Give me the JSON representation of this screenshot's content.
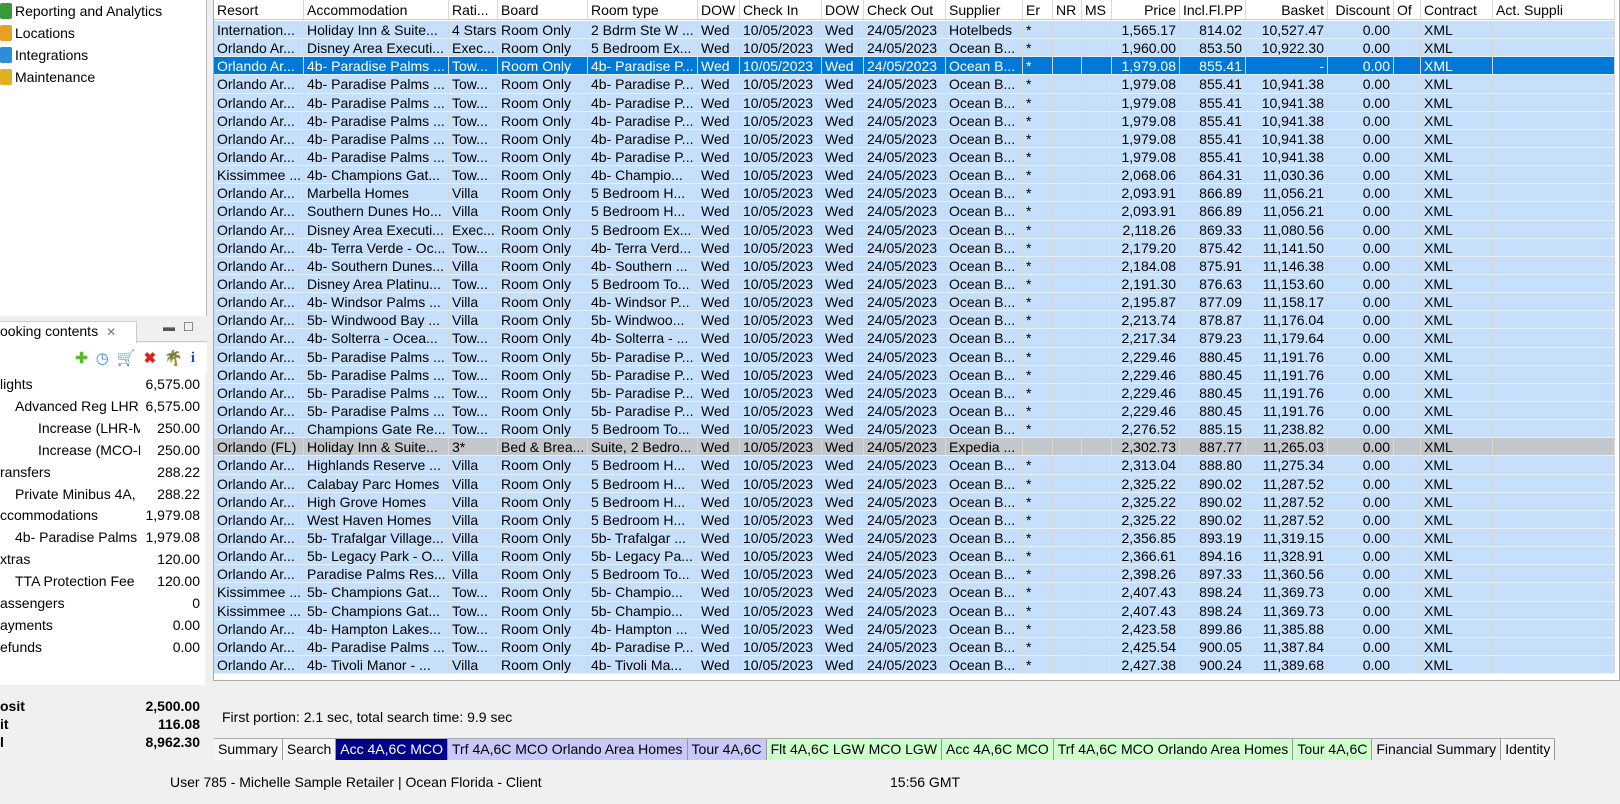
{
  "tree": [
    {
      "label": "Reporting and Analytics",
      "icon": "report-icon"
    },
    {
      "label": "Locations",
      "icon": "locations-icon"
    },
    {
      "label": "Integrations",
      "icon": "integrations-icon"
    },
    {
      "label": "Maintenance",
      "icon": "maintenance-icon"
    }
  ],
  "booking": {
    "title": "ooking contents",
    "rows": [
      {
        "label": "lights",
        "amount": "6,575.00",
        "indent": 0
      },
      {
        "label": "Advanced Reg LHR:",
        "amount": "6,575.00",
        "indent": 1
      },
      {
        "label": "Increase (LHR-M",
        "amount": "250.00",
        "indent": 2
      },
      {
        "label": "Increase (MCO-I",
        "amount": "250.00",
        "indent": 2
      },
      {
        "label": "ransfers",
        "amount": "288.22",
        "indent": 0
      },
      {
        "label": "Private Minibus  4A,",
        "amount": "288.22",
        "indent": 1
      },
      {
        "label": "ccommodations",
        "amount": "1,979.08",
        "indent": 0
      },
      {
        "label": "4b- Paradise Palms",
        "amount": "1,979.08",
        "indent": 1
      },
      {
        "label": "xtras",
        "amount": "120.00",
        "indent": 0
      },
      {
        "label": "TTA Protection Fee",
        "amount": "120.00",
        "indent": 1
      },
      {
        "label": "assengers",
        "amount": "0",
        "indent": 0
      },
      {
        "label": "ayments",
        "amount": "0.00",
        "indent": 0
      },
      {
        "label": "efunds",
        "amount": "0.00",
        "indent": 0
      }
    ],
    "totals": [
      {
        "label": "osit",
        "amount": "2,500.00"
      },
      {
        "label": "it",
        "amount": "116.08"
      },
      {
        "label": "l",
        "amount": "8,962.30"
      }
    ]
  },
  "table": {
    "columns": [
      "Resort",
      "Accommodation",
      "Rati...",
      "Board",
      "Room type",
      "DOW",
      "Check In",
      "DOW",
      "Check Out",
      "Supplier",
      "Er",
      "NR",
      "MS",
      "Price",
      "Incl.Fl.PP",
      "Basket",
      "Discount",
      "Of",
      "Contract",
      "Act. Suppli"
    ],
    "rows": [
      [
        "Internation...",
        "Holiday Inn & Suite...",
        "4 Stars",
        "Room Only",
        "2 Bdrm Ste W ...",
        "Wed",
        "10/05/2023",
        "Wed",
        "24/05/2023",
        "Hotelbeds",
        "*",
        "",
        "",
        "1,565.17",
        "814.02",
        "10,527.47",
        "0.00",
        "",
        "XML",
        ""
      ],
      [
        "Orlando Ar...",
        "Disney Area Executi...",
        "Exec...",
        "Room Only",
        "5 Bedroom Ex...",
        "Wed",
        "10/05/2023",
        "Wed",
        "24/05/2023",
        "Ocean B...",
        "*",
        "",
        "",
        "1,960.00",
        "853.50",
        "10,922.30",
        "0.00",
        "",
        "XML",
        ""
      ],
      [
        "Orlando Ar...",
        "4b- Paradise Palms ...",
        "Tow...",
        "Room Only",
        "4b- Paradise P...",
        "Wed",
        "10/05/2023",
        "Wed",
        "24/05/2023",
        "Ocean B...",
        "*",
        "",
        "",
        "1,979.08",
        "855.41",
        "-",
        "0.00",
        "",
        "XML",
        ""
      ],
      [
        "Orlando Ar...",
        "4b- Paradise Palms ...",
        "Tow...",
        "Room Only",
        "4b- Paradise P...",
        "Wed",
        "10/05/2023",
        "Wed",
        "24/05/2023",
        "Ocean B...",
        "*",
        "",
        "",
        "1,979.08",
        "855.41",
        "10,941.38",
        "0.00",
        "",
        "XML",
        ""
      ],
      [
        "Orlando Ar...",
        "4b- Paradise Palms ...",
        "Tow...",
        "Room Only",
        "4b- Paradise P...",
        "Wed",
        "10/05/2023",
        "Wed",
        "24/05/2023",
        "Ocean B...",
        "*",
        "",
        "",
        "1,979.08",
        "855.41",
        "10,941.38",
        "0.00",
        "",
        "XML",
        ""
      ],
      [
        "Orlando Ar...",
        "4b- Paradise Palms ...",
        "Tow...",
        "Room Only",
        "4b- Paradise P...",
        "Wed",
        "10/05/2023",
        "Wed",
        "24/05/2023",
        "Ocean B...",
        "*",
        "",
        "",
        "1,979.08",
        "855.41",
        "10,941.38",
        "0.00",
        "",
        "XML",
        ""
      ],
      [
        "Orlando Ar...",
        "4b- Paradise Palms ...",
        "Tow...",
        "Room Only",
        "4b- Paradise P...",
        "Wed",
        "10/05/2023",
        "Wed",
        "24/05/2023",
        "Ocean B...",
        "*",
        "",
        "",
        "1,979.08",
        "855.41",
        "10,941.38",
        "0.00",
        "",
        "XML",
        ""
      ],
      [
        "Orlando Ar...",
        "4b- Paradise Palms ...",
        "Tow...",
        "Room Only",
        "4b- Paradise P...",
        "Wed",
        "10/05/2023",
        "Wed",
        "24/05/2023",
        "Ocean B...",
        "*",
        "",
        "",
        "1,979.08",
        "855.41",
        "10,941.38",
        "0.00",
        "",
        "XML",
        ""
      ],
      [
        "Kissimmee ...",
        "4b- Champions Gat...",
        "Tow...",
        "Room Only",
        "4b- Champio...",
        "Wed",
        "10/05/2023",
        "Wed",
        "24/05/2023",
        "Ocean B...",
        "*",
        "",
        "",
        "2,068.06",
        "864.31",
        "11,030.36",
        "0.00",
        "",
        "XML",
        ""
      ],
      [
        "Orlando Ar...",
        "Marbella Homes",
        "Villa",
        "Room Only",
        "5 Bedroom H...",
        "Wed",
        "10/05/2023",
        "Wed",
        "24/05/2023",
        "Ocean B...",
        "*",
        "",
        "",
        "2,093.91",
        "866.89",
        "11,056.21",
        "0.00",
        "",
        "XML",
        ""
      ],
      [
        "Orlando Ar...",
        "Southern Dunes Ho...",
        "Villa",
        "Room Only",
        "5 Bedroom H...",
        "Wed",
        "10/05/2023",
        "Wed",
        "24/05/2023",
        "Ocean B...",
        "*",
        "",
        "",
        "2,093.91",
        "866.89",
        "11,056.21",
        "0.00",
        "",
        "XML",
        ""
      ],
      [
        "Orlando Ar...",
        "Disney Area Executi...",
        "Exec...",
        "Room Only",
        "5 Bedroom Ex...",
        "Wed",
        "10/05/2023",
        "Wed",
        "24/05/2023",
        "Ocean B...",
        "*",
        "",
        "",
        "2,118.26",
        "869.33",
        "11,080.56",
        "0.00",
        "",
        "XML",
        ""
      ],
      [
        "Orlando Ar...",
        "4b- Terra Verde - Oc...",
        "Tow...",
        "Room Only",
        "4b- Terra Verd...",
        "Wed",
        "10/05/2023",
        "Wed",
        "24/05/2023",
        "Ocean B...",
        "*",
        "",
        "",
        "2,179.20",
        "875.42",
        "11,141.50",
        "0.00",
        "",
        "XML",
        ""
      ],
      [
        "Orlando Ar...",
        "4b- Southern Dunes...",
        "Villa",
        "Room Only",
        "4b- Southern ...",
        "Wed",
        "10/05/2023",
        "Wed",
        "24/05/2023",
        "Ocean B...",
        "*",
        "",
        "",
        "2,184.08",
        "875.91",
        "11,146.38",
        "0.00",
        "",
        "XML",
        ""
      ],
      [
        "Orlando Ar...",
        "Disney Area Platinu...",
        "Tow...",
        "Room Only",
        "5 Bedroom To...",
        "Wed",
        "10/05/2023",
        "Wed",
        "24/05/2023",
        "Ocean B...",
        "*",
        "",
        "",
        "2,191.30",
        "876.63",
        "11,153.60",
        "0.00",
        "",
        "XML",
        ""
      ],
      [
        "Orlando Ar...",
        "4b- Windsor Palms ...",
        "Villa",
        "Room Only",
        "4b- Windsor P...",
        "Wed",
        "10/05/2023",
        "Wed",
        "24/05/2023",
        "Ocean B...",
        "*",
        "",
        "",
        "2,195.87",
        "877.09",
        "11,158.17",
        "0.00",
        "",
        "XML",
        ""
      ],
      [
        "Orlando Ar...",
        "5b- Windwood Bay ...",
        "Villa",
        "Room Only",
        "5b- Windwoo...",
        "Wed",
        "10/05/2023",
        "Wed",
        "24/05/2023",
        "Ocean B...",
        "*",
        "",
        "",
        "2,213.74",
        "878.87",
        "11,176.04",
        "0.00",
        "",
        "XML",
        ""
      ],
      [
        "Orlando Ar...",
        "4b- Solterra - Ocea...",
        "Tow...",
        "Room Only",
        "4b- Solterra - ...",
        "Wed",
        "10/05/2023",
        "Wed",
        "24/05/2023",
        "Ocean B...",
        "*",
        "",
        "",
        "2,217.34",
        "879.23",
        "11,179.64",
        "0.00",
        "",
        "XML",
        ""
      ],
      [
        "Orlando Ar...",
        "5b- Paradise Palms ...",
        "Tow...",
        "Room Only",
        "5b- Paradise P...",
        "Wed",
        "10/05/2023",
        "Wed",
        "24/05/2023",
        "Ocean B...",
        "*",
        "",
        "",
        "2,229.46",
        "880.45",
        "11,191.76",
        "0.00",
        "",
        "XML",
        ""
      ],
      [
        "Orlando Ar...",
        "5b- Paradise Palms ...",
        "Tow...",
        "Room Only",
        "5b- Paradise P...",
        "Wed",
        "10/05/2023",
        "Wed",
        "24/05/2023",
        "Ocean B...",
        "*",
        "",
        "",
        "2,229.46",
        "880.45",
        "11,191.76",
        "0.00",
        "",
        "XML",
        ""
      ],
      [
        "Orlando Ar...",
        "5b- Paradise Palms ...",
        "Tow...",
        "Room Only",
        "5b- Paradise P...",
        "Wed",
        "10/05/2023",
        "Wed",
        "24/05/2023",
        "Ocean B...",
        "*",
        "",
        "",
        "2,229.46",
        "880.45",
        "11,191.76",
        "0.00",
        "",
        "XML",
        ""
      ],
      [
        "Orlando Ar...",
        "5b- Paradise Palms ...",
        "Tow...",
        "Room Only",
        "5b- Paradise P...",
        "Wed",
        "10/05/2023",
        "Wed",
        "24/05/2023",
        "Ocean B...",
        "*",
        "",
        "",
        "2,229.46",
        "880.45",
        "11,191.76",
        "0.00",
        "",
        "XML",
        ""
      ],
      [
        "Orlando Ar...",
        "Champions Gate Re...",
        "Tow...",
        "Room Only",
        "5 Bedroom To...",
        "Wed",
        "10/05/2023",
        "Wed",
        "24/05/2023",
        "Ocean B...",
        "*",
        "",
        "",
        "2,276.52",
        "885.15",
        "11,238.82",
        "0.00",
        "",
        "XML",
        ""
      ],
      [
        "Orlando (FL)",
        "Holiday Inn & Suite...",
        "3*",
        "Bed & Brea...",
        "Suite, 2 Bedro...",
        "Wed",
        "10/05/2023",
        "Wed",
        "24/05/2023",
        "Expedia ...",
        "",
        "",
        "",
        "2,302.73",
        "887.77",
        "11,265.03",
        "0.00",
        "",
        "XML",
        ""
      ],
      [
        "Orlando Ar...",
        "Highlands Reserve ...",
        "Villa",
        "Room Only",
        "5 Bedroom H...",
        "Wed",
        "10/05/2023",
        "Wed",
        "24/05/2023",
        "Ocean B...",
        "*",
        "",
        "",
        "2,313.04",
        "888.80",
        "11,275.34",
        "0.00",
        "",
        "XML",
        ""
      ],
      [
        "Orlando Ar...",
        "Calabay Parc Homes",
        "Villa",
        "Room Only",
        "5 Bedroom H...",
        "Wed",
        "10/05/2023",
        "Wed",
        "24/05/2023",
        "Ocean B...",
        "*",
        "",
        "",
        "2,325.22",
        "890.02",
        "11,287.52",
        "0.00",
        "",
        "XML",
        ""
      ],
      [
        "Orlando Ar...",
        "High Grove Homes",
        "Villa",
        "Room Only",
        "5 Bedroom H...",
        "Wed",
        "10/05/2023",
        "Wed",
        "24/05/2023",
        "Ocean B...",
        "*",
        "",
        "",
        "2,325.22",
        "890.02",
        "11,287.52",
        "0.00",
        "",
        "XML",
        ""
      ],
      [
        "Orlando Ar...",
        "West Haven Homes",
        "Villa",
        "Room Only",
        "5 Bedroom H...",
        "Wed",
        "10/05/2023",
        "Wed",
        "24/05/2023",
        "Ocean B...",
        "*",
        "",
        "",
        "2,325.22",
        "890.02",
        "11,287.52",
        "0.00",
        "",
        "XML",
        ""
      ],
      [
        "Orlando Ar...",
        "5b- Trafalgar Village...",
        "Villa",
        "Room Only",
        "5b- Trafalgar ...",
        "Wed",
        "10/05/2023",
        "Wed",
        "24/05/2023",
        "Ocean B...",
        "*",
        "",
        "",
        "2,356.85",
        "893.19",
        "11,319.15",
        "0.00",
        "",
        "XML",
        ""
      ],
      [
        "Orlando Ar...",
        "5b- Legacy Park - O...",
        "Villa",
        "Room Only",
        "5b- Legacy Pa...",
        "Wed",
        "10/05/2023",
        "Wed",
        "24/05/2023",
        "Ocean B...",
        "*",
        "",
        "",
        "2,366.61",
        "894.16",
        "11,328.91",
        "0.00",
        "",
        "XML",
        ""
      ],
      [
        "Orlando Ar...",
        "Paradise Palms Res...",
        "Villa",
        "Room Only",
        "5 Bedroom To...",
        "Wed",
        "10/05/2023",
        "Wed",
        "24/05/2023",
        "Ocean B...",
        "*",
        "",
        "",
        "2,398.26",
        "897.33",
        "11,360.56",
        "0.00",
        "",
        "XML",
        ""
      ],
      [
        "Kissimmee ...",
        "5b- Champions Gat...",
        "Tow...",
        "Room Only",
        "5b- Champio...",
        "Wed",
        "10/05/2023",
        "Wed",
        "24/05/2023",
        "Ocean B...",
        "*",
        "",
        "",
        "2,407.43",
        "898.24",
        "11,369.73",
        "0.00",
        "",
        "XML",
        ""
      ],
      [
        "Kissimmee ...",
        "5b- Champions Gat...",
        "Tow...",
        "Room Only",
        "5b- Champio...",
        "Wed",
        "10/05/2023",
        "Wed",
        "24/05/2023",
        "Ocean B...",
        "*",
        "",
        "",
        "2,407.43",
        "898.24",
        "11,369.73",
        "0.00",
        "",
        "XML",
        ""
      ],
      [
        "Orlando Ar...",
        "4b- Hampton Lakes...",
        "Tow...",
        "Room Only",
        "4b- Hampton ...",
        "Wed",
        "10/05/2023",
        "Wed",
        "24/05/2023",
        "Ocean B...",
        "*",
        "",
        "",
        "2,423.58",
        "899.86",
        "11,385.88",
        "0.00",
        "",
        "XML",
        ""
      ],
      [
        "Orlando Ar...",
        "4b- Paradise Palms ...",
        "Tow...",
        "Room Only",
        "4b- Paradise P...",
        "Wed",
        "10/05/2023",
        "Wed",
        "24/05/2023",
        "Ocean B...",
        "*",
        "",
        "",
        "2,425.54",
        "900.05",
        "11,387.84",
        "0.00",
        "",
        "XML",
        ""
      ],
      [
        "Orlando Ar...",
        "4b- Tivoli Manor - ...",
        "Villa",
        "Room Only",
        "4b- Tivoli Ma...",
        "Wed",
        "10/05/2023",
        "Wed",
        "24/05/2023",
        "Ocean B...",
        "*",
        "",
        "",
        "2,427.38",
        "900.24",
        "11,389.68",
        "0.00",
        "",
        "XML",
        ""
      ]
    ],
    "selected_row": 2,
    "highlighted_row": 23,
    "sort_column": "Basket"
  },
  "status_message": "First portion: 2.1 sec, total search time: 9.9 sec",
  "tabs": [
    {
      "label": "Summary",
      "style": "w"
    },
    {
      "label": "Search",
      "style": "w"
    },
    {
      "label": "Acc 4A,6C MCO",
      "style": "sel"
    },
    {
      "label": "Trf 4A,6C MCO Orlando Area Homes",
      "style": "lav"
    },
    {
      "label": "Tour 4A,6C",
      "style": "lav"
    },
    {
      "label": "Flt 4A,6C LGW MCO LGW",
      "style": "grn"
    },
    {
      "label": "Acc 4A,6C MCO",
      "style": "grn"
    },
    {
      "label": "Trf 4A,6C MCO Orlando Area Homes",
      "style": "grn"
    },
    {
      "label": "Tour 4A,6C",
      "style": "grn"
    },
    {
      "label": "Financial Summary",
      "style": "gry"
    },
    {
      "label": "Identity",
      "style": "w"
    }
  ],
  "statusbar": {
    "user": "User 785 - Michelle Sample Retailer | Ocean Florida - Client",
    "time": "15:56 GMT"
  },
  "colors": {
    "row": "#c6e0fb",
    "selected": "#0078d7",
    "gray_row": "#c3c7cb",
    "active_tab": "#00008b"
  }
}
